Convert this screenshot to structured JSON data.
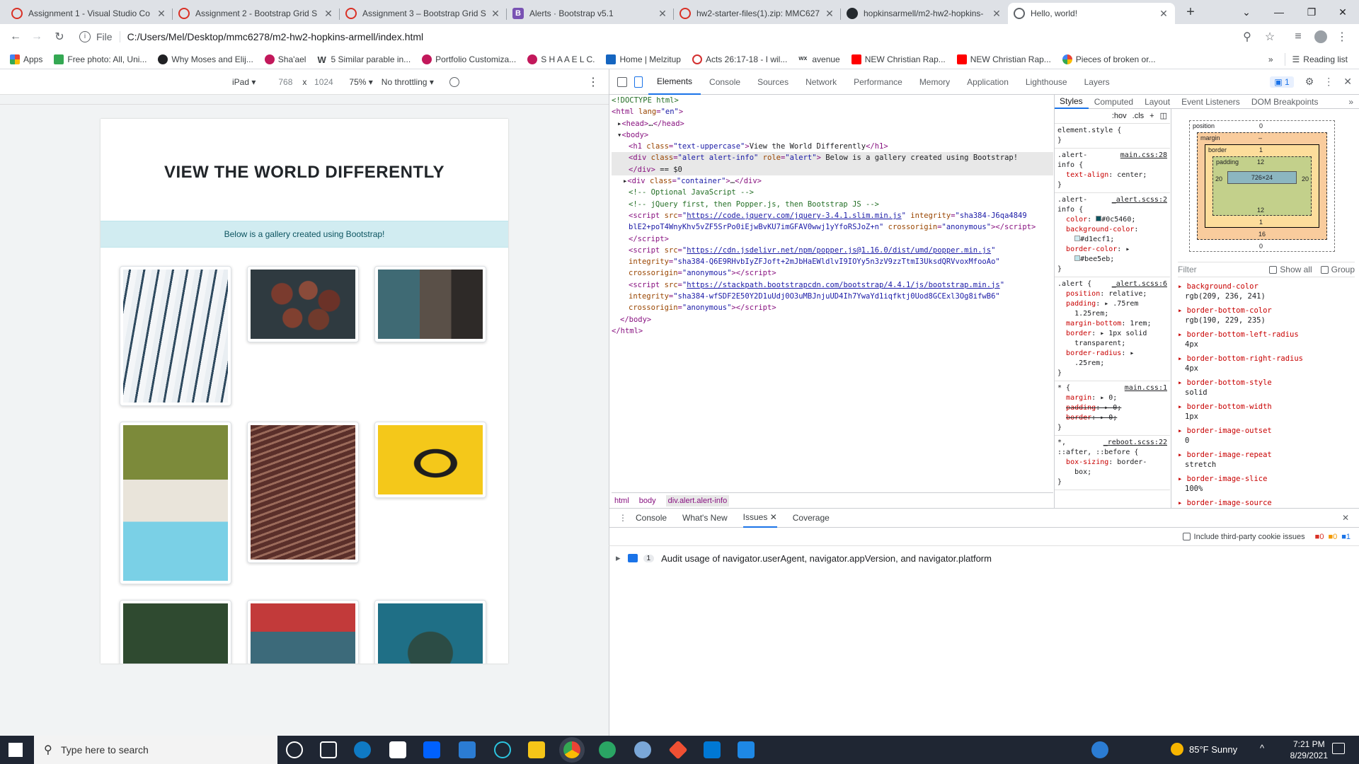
{
  "tabs": [
    {
      "title": "Assignment 1 - Visual Studio Co",
      "color": "#d93025"
    },
    {
      "title": "Assignment 2 - Bootstrap Grid S",
      "color": "#d93025"
    },
    {
      "title": "Assignment 3 – Bootstrap Grid S",
      "color": "#d93025"
    },
    {
      "title": "Alerts · Bootstrap v5.1",
      "color": "#7952b3"
    },
    {
      "title": "hw2-starter-files(1).zip: MMC627",
      "color": "#d93025"
    },
    {
      "title": "hopkinsarmell/m2-hw2-hopkins-",
      "color": "#24292e"
    },
    {
      "title": "Hello, world!",
      "color": "#5f6368"
    }
  ],
  "address": {
    "scheme": "File",
    "url": "C:/Users/Mel/Desktop/mmc6278/m2-hw2-hopkins-armell/index.html"
  },
  "bookmarks": [
    {
      "label": "Apps",
      "color": "#ea4335"
    },
    {
      "label": "Free photo: All, Uni...",
      "color": "#34a853"
    },
    {
      "label": "Why Moses and Elij...",
      "color": "#202124"
    },
    {
      "label": "Sha'ael",
      "color": "#c2185b"
    },
    {
      "label": "5 Similar parable in...",
      "color": "#202124"
    },
    {
      "label": "Portfolio Customiza...",
      "color": "#c2185b"
    },
    {
      "label": "S H A A E L C.",
      "color": "#c2185b"
    },
    {
      "label": "Home | Melzitup",
      "color": "#1565c0"
    },
    {
      "label": "Acts 26:17-18 - I wil...",
      "color": "#d32f2f"
    },
    {
      "label": "avenue",
      "color": "#202124"
    },
    {
      "label": "NEW Christian Rap...",
      "color": "#ff0000"
    },
    {
      "label": "NEW Christian Rap...",
      "color": "#ff0000"
    },
    {
      "label": "Pieces of broken or...",
      "color": "#4285f4"
    }
  ],
  "reading_list": "Reading list",
  "device": {
    "name": "iPad",
    "width": "768",
    "height": "1024",
    "zoom": "75%",
    "throttle": "No throttling"
  },
  "page": {
    "heading": "View the World Differently",
    "alert": "Below is a gallery created using Bootstrap!"
  },
  "devtools": {
    "tabs": [
      "Elements",
      "Console",
      "Sources",
      "Network",
      "Performance",
      "Memory",
      "Application",
      "Lighthouse",
      "Layers"
    ],
    "issues_count": "1",
    "crumbs": [
      "html",
      "body",
      "div.alert.alert-info"
    ],
    "style_tabs": [
      "Styles",
      "Computed",
      "Layout",
      "Event Listeners",
      "DOM Breakpoints"
    ],
    "hov": ":hov",
    "cls": ".cls",
    "box": {
      "position_label": "position",
      "position": "0",
      "margin_label": "margin",
      "margin": "–",
      "border_label": "border",
      "border_top": "1",
      "border_side": "1",
      "padding_label": "padding",
      "padding_top": "12",
      "padding_bottom": "12",
      "padding_side": "20",
      "content": "726×24",
      "margin_bottom": "16",
      "position_bottom": "0",
      "border_bottom": "1"
    },
    "filter": "Filter",
    "show_all": "Show all",
    "group": "Group",
    "computed": [
      {
        "name": "background-color",
        "value": "rgb(209, 236, 241)"
      },
      {
        "name": "border-bottom-color",
        "value": "rgb(190, 229, 235)"
      },
      {
        "name": "border-bottom-left-radius",
        "value": "4px"
      },
      {
        "name": "border-bottom-right-radius",
        "value": "4px"
      },
      {
        "name": "border-bottom-style",
        "value": "solid"
      },
      {
        "name": "border-bottom-width",
        "value": "1px"
      },
      {
        "name": "border-image-outset",
        "value": "0"
      },
      {
        "name": "border-image-repeat",
        "value": "stretch"
      },
      {
        "name": "border-image-slice",
        "value": "100%"
      },
      {
        "name": "border-image-source",
        "value": ""
      }
    ],
    "drawer_tabs": [
      "Console",
      "What's New",
      "Issues",
      "Coverage"
    ],
    "third_party": "Include third-party cookie issues",
    "issue_counts": [
      "0",
      "0",
      "1"
    ],
    "issue_count": "1",
    "issue": "Audit usage of navigator.userAgent, navigator.appVersion, and navigator.platform"
  },
  "taskbar": {
    "search": "Type here to search",
    "weather": "85°F  Sunny",
    "time": "7:21 PM",
    "date": "8/29/2021"
  }
}
